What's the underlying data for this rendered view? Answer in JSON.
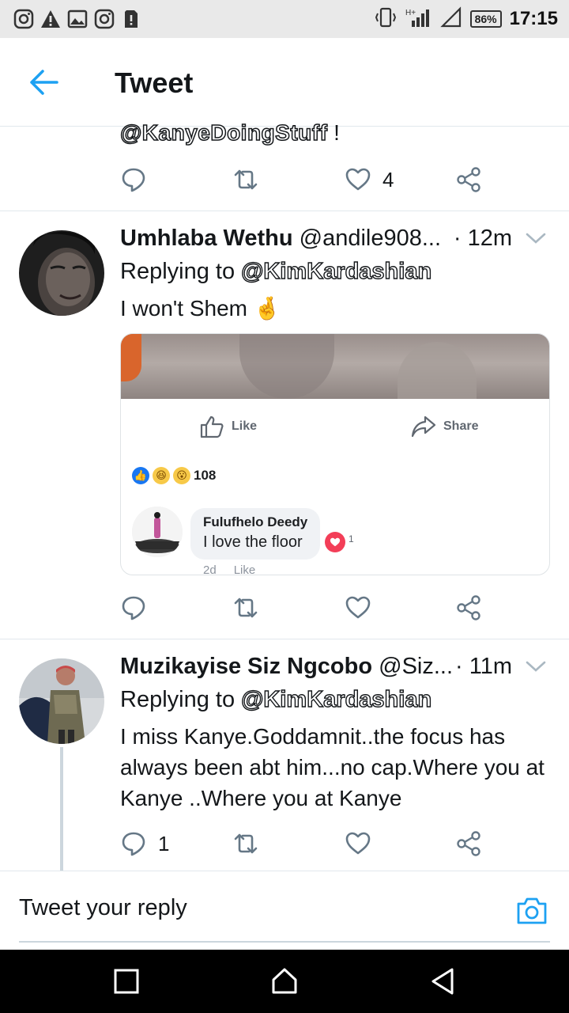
{
  "status_bar": {
    "battery": "86%",
    "time": "17:15",
    "icons": [
      "instagram-icon",
      "warning-icon",
      "image-icon",
      "instagram-icon",
      "sim-alert-icon",
      "vibrate-icon",
      "signal-icon",
      "battery-icon"
    ]
  },
  "header": {
    "title": "Tweet",
    "back_icon": "arrow-left-icon"
  },
  "previous_tweet": {
    "text_end": "@KanyeDoingStuff",
    "text_suffix": " !",
    "like_count": "4"
  },
  "tweets": [
    {
      "name": "Umhlaba Wethu",
      "handle": "@andile908...",
      "time": "· 12m",
      "replying_label": "Replying to ",
      "replying_to": "@KimKardashian",
      "text": "I won't Shem",
      "emoji": "🤞",
      "reply_count": "",
      "embedded": {
        "like_label": "Like",
        "share_label": "Share",
        "reaction_count": "108",
        "comment_author": "Fulufhelo Deedy",
        "comment_text": "I love the floor",
        "comment_heart_count": "1",
        "comment_age": "2d",
        "comment_like": "Like"
      }
    },
    {
      "name": "Muzikayise Siz Ngcobo",
      "handle": "@Siz...",
      "time": "· 11m",
      "replying_label": "Replying to ",
      "replying_to": "@KimKardashian",
      "text": "I miss Kanye.Goddamnit..the focus has always been abt him...no cap.Where you at Kanye ..Where you at Kanye",
      "reply_count": "1"
    }
  ],
  "composer": {
    "placeholder": "Tweet your reply"
  },
  "colors": {
    "accent": "#1da1f2",
    "icon_gray": "#657786",
    "divider": "#e1e8ed"
  }
}
